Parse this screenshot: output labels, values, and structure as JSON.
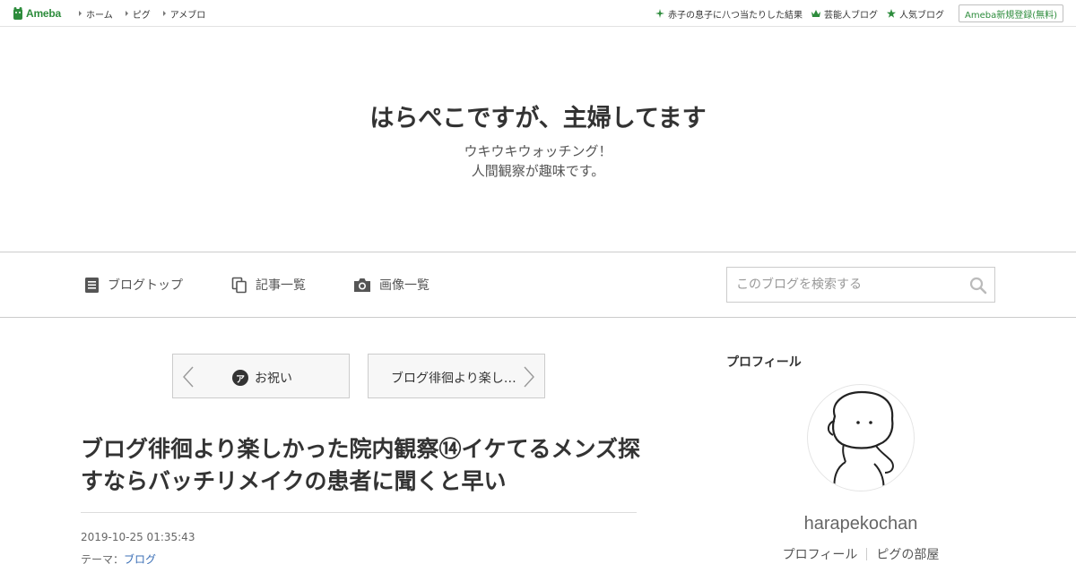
{
  "topbar": {
    "logo_text": "Ameba",
    "nav": [
      "ホーム",
      "ピグ",
      "アメブロ"
    ],
    "right_links": [
      {
        "label": "赤子の息子に八つ当たりした結果",
        "icon": "sparkle-icon"
      },
      {
        "label": "芸能人ブログ",
        "icon": "crown-icon"
      },
      {
        "label": "人気ブログ",
        "icon": "star-icon"
      }
    ],
    "signup_label": "Ameba新規登録(無料)",
    "accent": "#2d8c3c"
  },
  "header": {
    "title": "はらぺこですが、主婦してます",
    "desc_line1": "ウキウキウォッチング！",
    "desc_line2": "人間観察が趣味です。"
  },
  "navbar": {
    "items": [
      {
        "label": "ブログトップ",
        "icon": "document-icon"
      },
      {
        "label": "記事一覧",
        "icon": "copy-icon"
      },
      {
        "label": "画像一覧",
        "icon": "camera-icon"
      }
    ],
    "search_placeholder": "このブログを検索する"
  },
  "pager": {
    "prev_label": "お祝い",
    "prev_badge": "ア",
    "next_label": "ブログ徘徊より楽し…"
  },
  "article": {
    "title": "ブログ徘徊より楽しかった院内観察⑭イケてるメンズ探すならバッチリメイクの患者に聞くと早い",
    "date": "2019-10-25 01:35:43",
    "theme_label": "テーマ：",
    "theme_value": "ブログ"
  },
  "sidebar": {
    "heading": "プロフィール",
    "username": "harapekochan",
    "links": [
      "プロフィール",
      "ピグの部屋"
    ]
  }
}
